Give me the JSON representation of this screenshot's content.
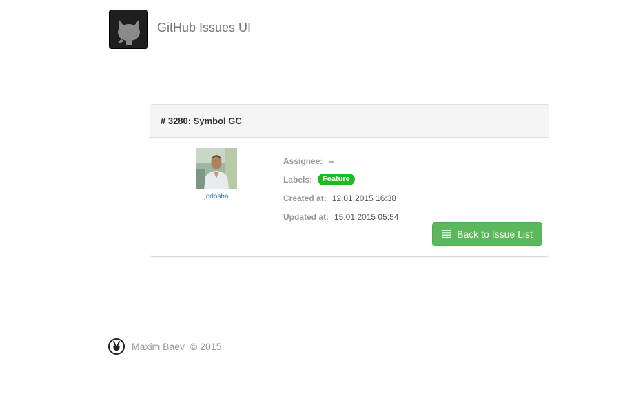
{
  "header": {
    "logo_icon": "github-octocat-icon",
    "title": "GitHub Issues UI"
  },
  "issue": {
    "heading": "# 3280: Symbol GC",
    "user": {
      "avatar_icon": "user-avatar-photo",
      "login": "jodosha"
    },
    "fields": {
      "assignee_label": "Assignee:",
      "assignee_value": "--",
      "labels_label": "Labels:",
      "label_badge": "Feature",
      "label_color": "#1fba1f",
      "created_label": "Created at:",
      "created_value": "12.01.2015 16:38",
      "updated_label": "Updated at:",
      "updated_value": "15.01.2015 05:54"
    },
    "back_button": {
      "icon": "list-icon",
      "label": "Back to Issue List",
      "color": "#5cb85c"
    }
  },
  "footer": {
    "logo_icon": "peace-hand-icon",
    "author": "Maxim Baev",
    "copyright": "© 2015"
  }
}
